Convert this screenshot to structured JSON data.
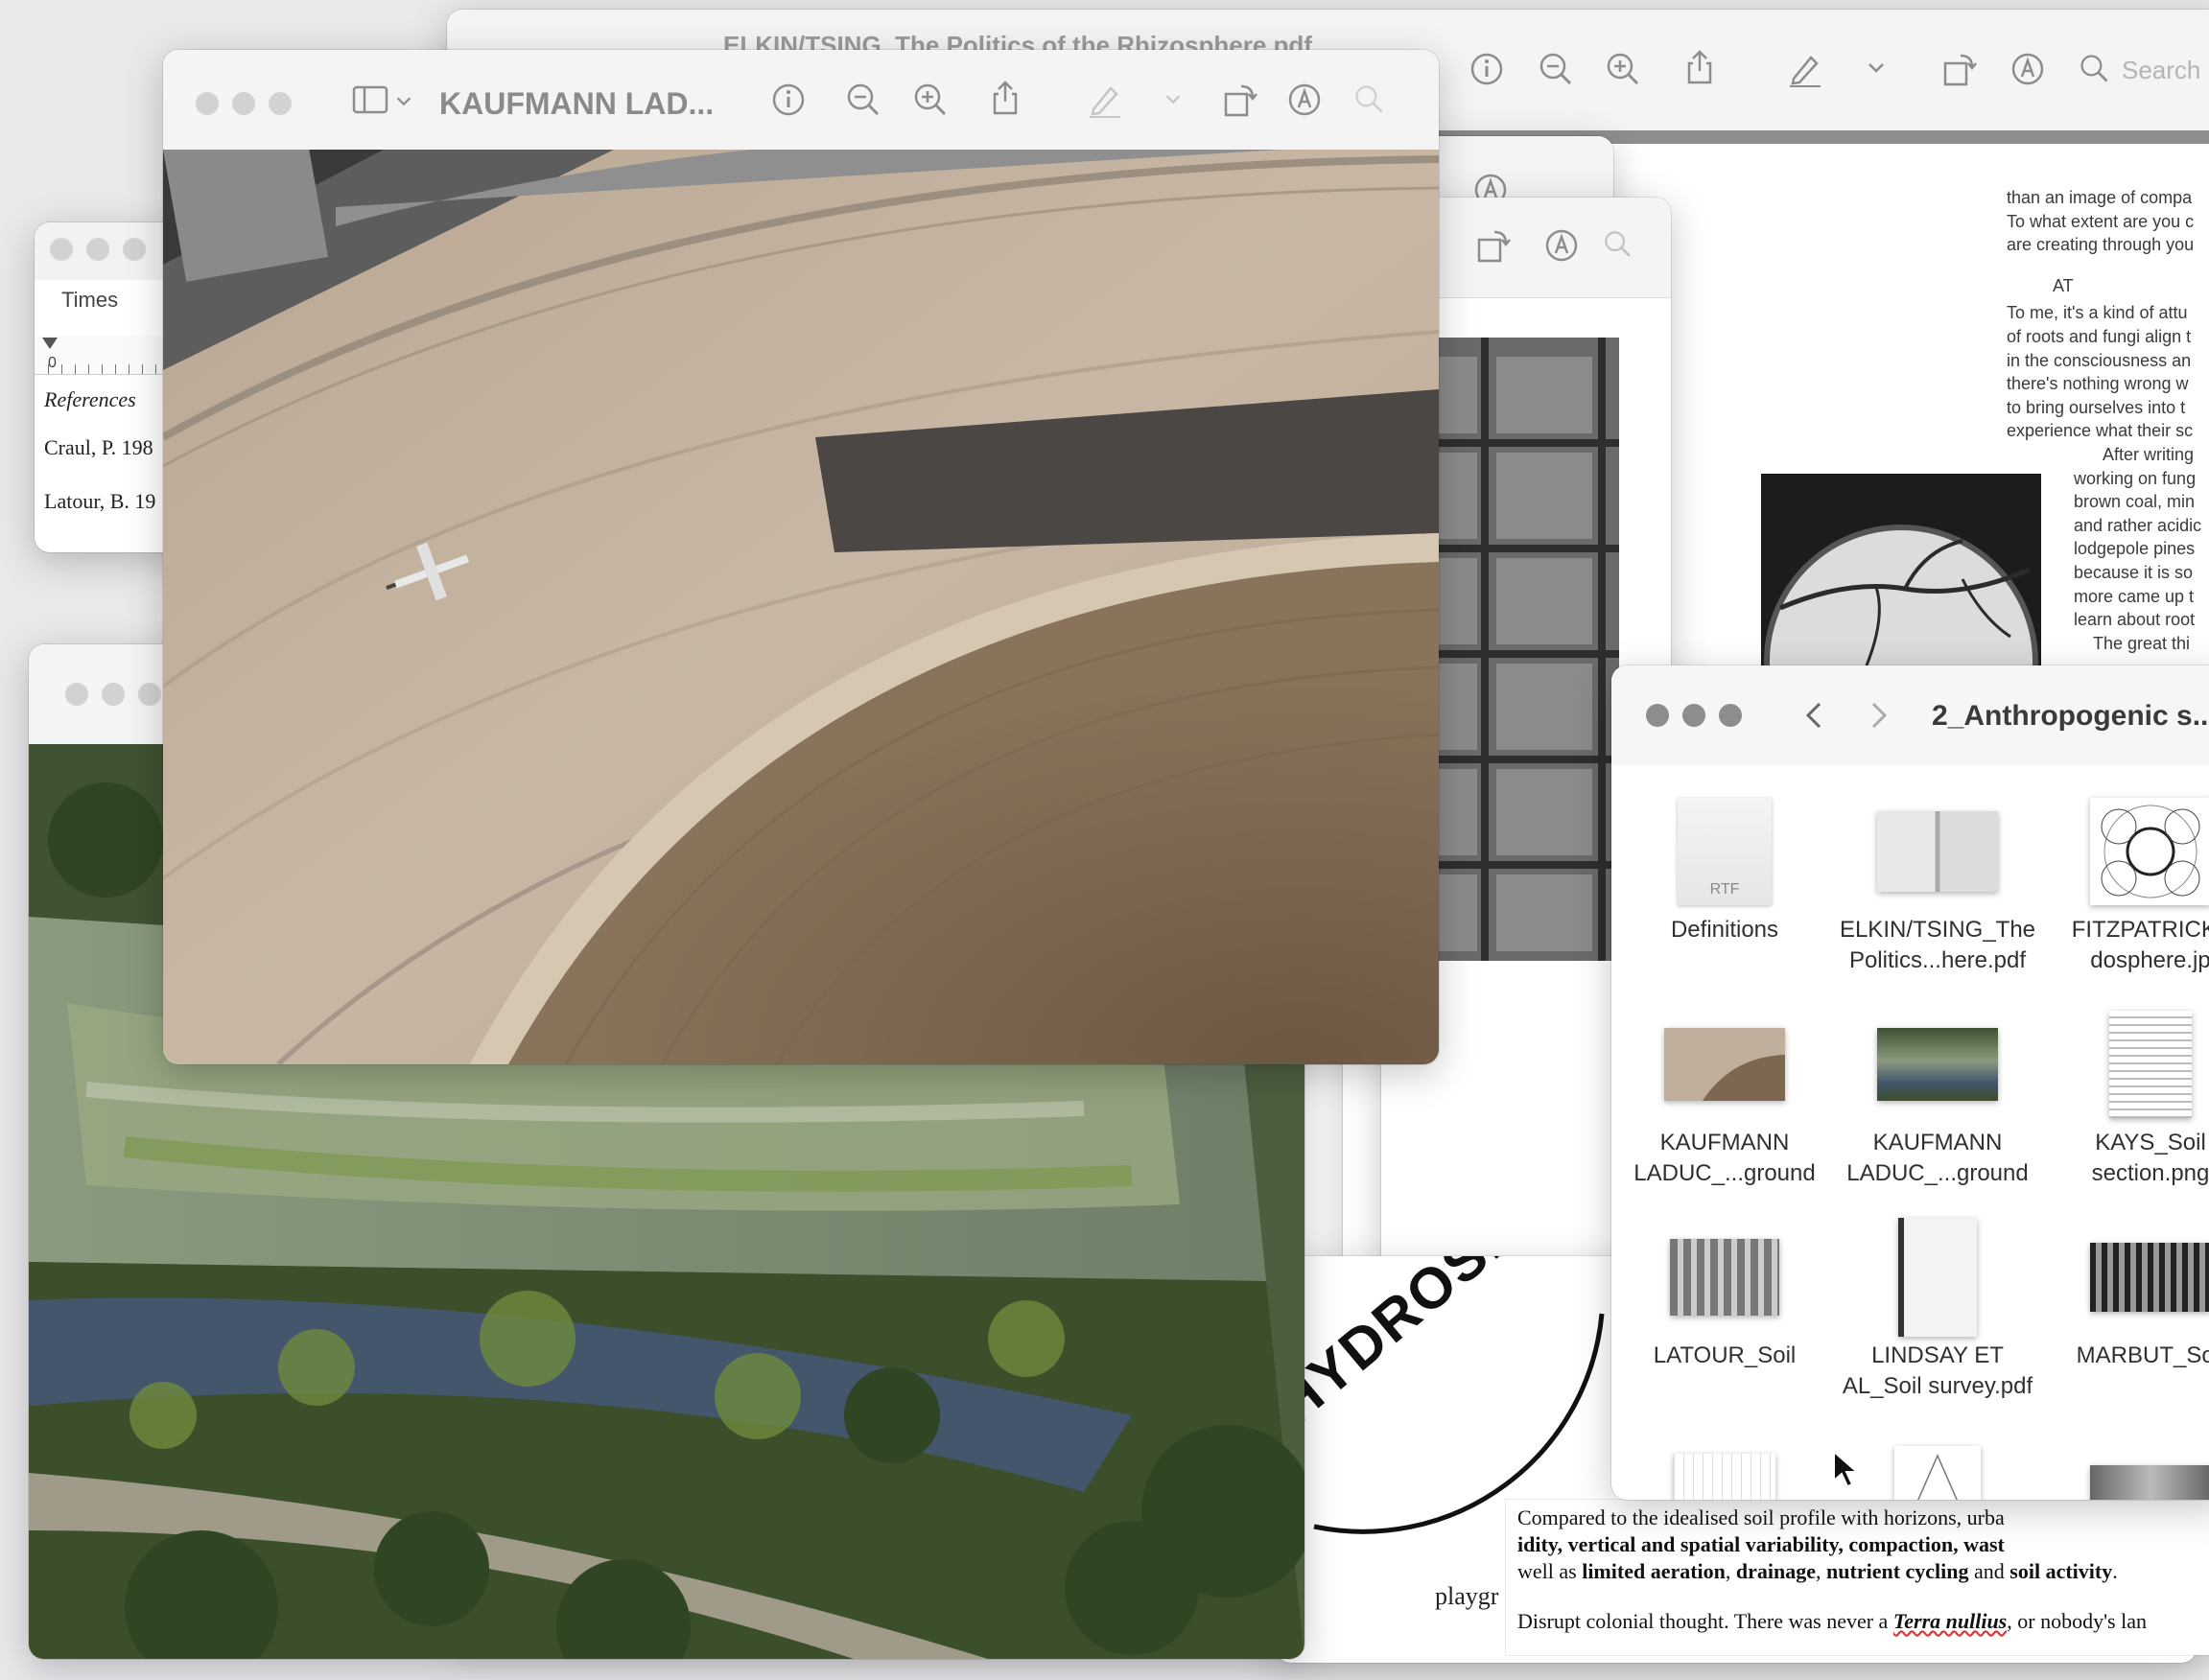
{
  "back_pdf_window": {
    "title": "ELKIN/TSING_The Politics of the Rhizosphere.pdf",
    "search_placeholder": "Search",
    "text_lines": [
      "than an image of compa",
      "To what extent are you c",
      "are creating through you",
      "AT",
      "To me, it's a kind of attu",
      "of roots and fungi align t",
      "in the consciousness an",
      "there's nothing wrong w",
      "to bring ourselves into t",
      "experience what their sc",
      "After writing",
      "working on fung",
      "brown coal, min",
      "and rather acidic",
      "lodgepole pines",
      "because it is so",
      "more came up t",
      "learn about root",
      "The great thi"
    ]
  },
  "textedit_window": {
    "font_name": "Times",
    "ruler_zero": "0",
    "references_heading": "References",
    "ref_1": "Craul, P. 198",
    "ref_2": "Latour, B. 19"
  },
  "main_preview_window": {
    "title": "KAUFMANN LAD..."
  },
  "hydrosphere_label": "HYDROSPHE",
  "playground_fragment": "playgr",
  "doc_bottom": {
    "line_1": "Compared to the idealised soil profile with horizons, urba",
    "line_2a": "idity, ",
    "line_2b": "vertical and spatial variability",
    "line_2c": ", ",
    "line_2d": "compaction",
    "line_2e": ", ",
    "line_2f": "wast",
    "line_3a": "well as ",
    "line_3b": "limited aeration",
    "line_3c": ", ",
    "line_3d": "drainage",
    "line_3e": ", ",
    "line_3f": "nutrient cycling",
    "line_3g": " and ",
    "line_3h": "soil activity",
    "line_3i": ".",
    "line_4a": "Disrupt colonial thought. There was never a ",
    "line_4b": "Terra nullius",
    "line_4c": ", or nobody's lan"
  },
  "finder": {
    "folder_title": "2_Anthropogenic s...",
    "items": [
      {
        "line1": "Definitions",
        "line2": "",
        "badge": "RTF"
      },
      {
        "line1": "ELKIN/TSING_The",
        "line2": "Politics...here.pdf"
      },
      {
        "line1": "FITZPATRICK_",
        "line2": "dosphere.jp"
      },
      {
        "line1": "KAUFMANN",
        "line2": "LADUC_...ground"
      },
      {
        "line1": "KAUFMANN",
        "line2": "LADUC_...ground"
      },
      {
        "line1": "KAYS_Soil",
        "line2": "section.png"
      },
      {
        "line1": "LATOUR_Soil",
        "line2": ""
      },
      {
        "line1": "LINDSAY ET",
        "line2": "AL_Soil survey.pdf"
      },
      {
        "line1": "MARBUT_Soil",
        "line2": ""
      }
    ],
    "hydrosphere_thumb_text": "HYDROSPHERE"
  },
  "colors": {
    "desktop": "#e9e9eb",
    "titlebar": "#f4f4f4",
    "concrete": "#bfae9b",
    "soil": "#7e6750"
  }
}
